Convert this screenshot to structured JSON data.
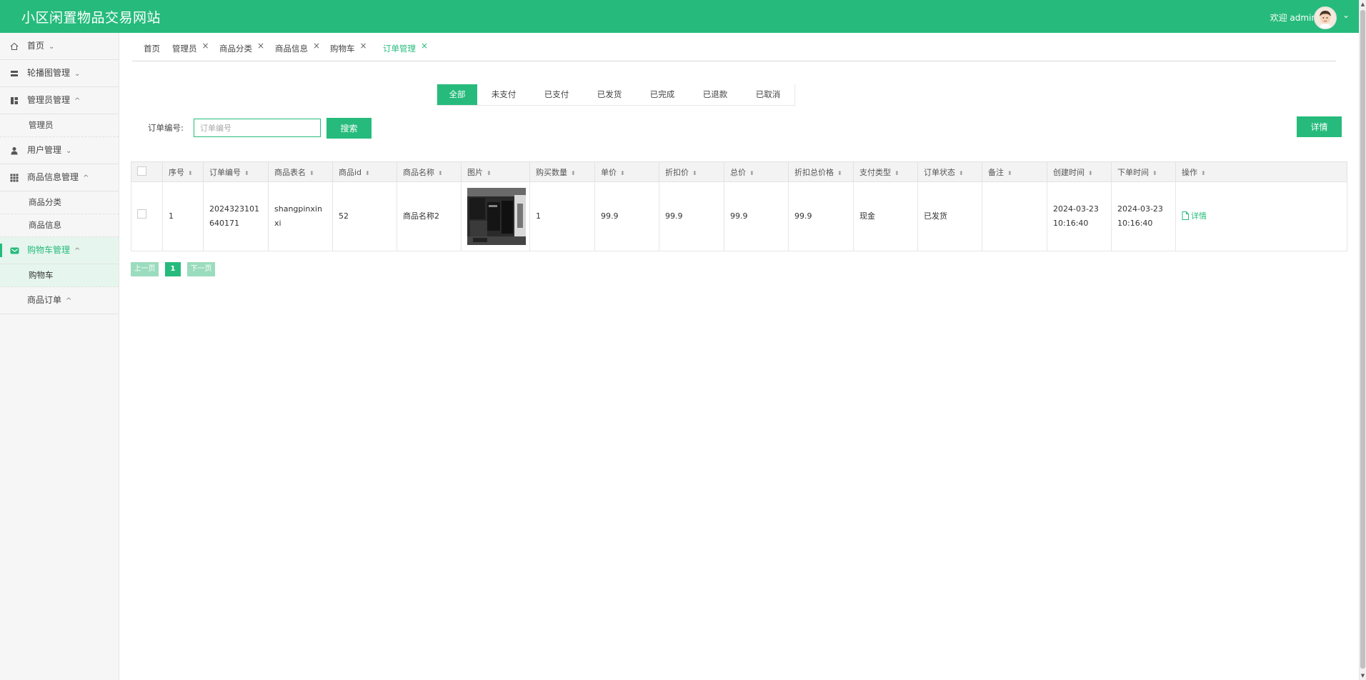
{
  "header": {
    "title": "小区闲置物品交易网站",
    "welcome": "欢迎 admin"
  },
  "sidebar": {
    "items": [
      {
        "label": "首页",
        "icon": "home-icon",
        "caret": "⌄"
      },
      {
        "label": "轮播图管理",
        "icon": "carousel-icon",
        "caret": "⌄"
      },
      {
        "label": "管理员管理",
        "icon": "dashboard-icon",
        "caret": "^",
        "sub": [
          "管理员"
        ]
      },
      {
        "label": "用户管理",
        "icon": "user-icon",
        "caret": "⌄"
      },
      {
        "label": "商品信息管理",
        "icon": "grid-icon",
        "caret": "^",
        "sub": [
          "商品分类",
          "商品信息"
        ]
      },
      {
        "label": "购物车管理",
        "icon": "cart-icon",
        "caret": "^",
        "sub": [
          "购物车"
        ]
      },
      {
        "label": "商品订单",
        "caret": "^"
      }
    ]
  },
  "tabs": [
    {
      "label": "首页"
    },
    {
      "label": "管理员",
      "close": "×"
    },
    {
      "label": "商品分类",
      "close": "×"
    },
    {
      "label": "商品信息",
      "close": "×"
    },
    {
      "label": "购物车",
      "close": "×"
    },
    {
      "label": "订单管理",
      "close": "×"
    }
  ],
  "status_filters": [
    "全部",
    "未支付",
    "已支付",
    "已发货",
    "已完成",
    "已退款",
    "已取消"
  ],
  "search": {
    "label": "订单编号:",
    "placeholder": "订单编号",
    "button": "搜索"
  },
  "detail_button": "详情",
  "table": {
    "headers": [
      "序号",
      "订单编号",
      "商品表名",
      "商品id",
      "商品名称",
      "图片",
      "购买数量",
      "单价",
      "折扣价",
      "总价",
      "折扣总价格",
      "支付类型",
      "订单状态",
      "备注",
      "创建时间",
      "下单时间",
      "操作"
    ],
    "sort_icon": "⬍",
    "rows": [
      {
        "index": "1",
        "order_no": "2024323101640171",
        "table_name": "shangpinxinxi",
        "goods_id": "52",
        "goods_name": "商品名称2",
        "qty": "1",
        "price": "99.9",
        "discount_price": "99.9",
        "total": "99.9",
        "discount_total": "99.9",
        "pay_type": "现金",
        "status": "已发货",
        "remark": "",
        "created": "2024-03-23 10:16:40",
        "ordered": "2024-03-23 10:16:40",
        "op": "详情"
      }
    ]
  },
  "pager": {
    "prev": "上一页",
    "page": "1",
    "next": "下一页"
  },
  "colors": {
    "accent": "#26bb7c",
    "accent_light": "#9adcbd"
  }
}
